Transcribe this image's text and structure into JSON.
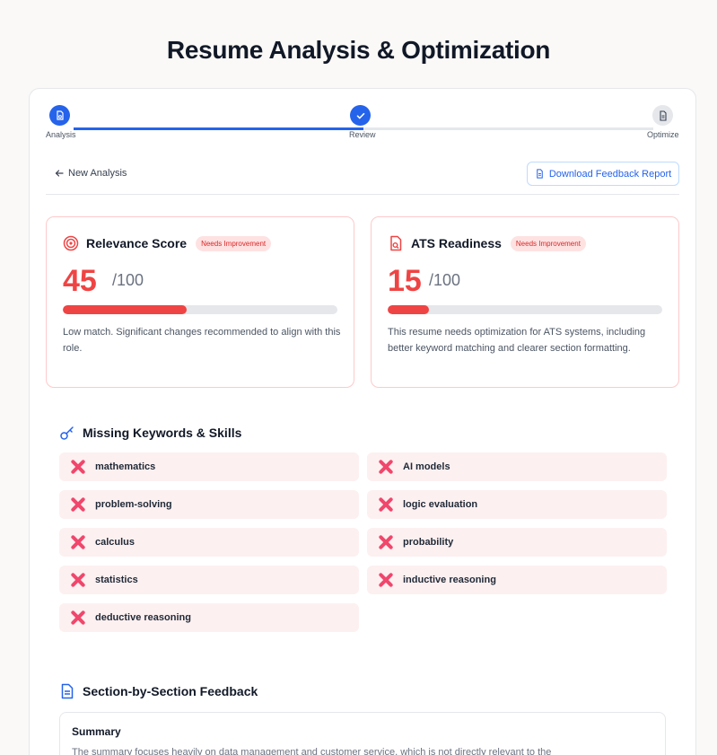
{
  "page_title": "Resume Analysis & Optimization",
  "stepper": {
    "steps": [
      {
        "label": "Analysis",
        "icon": "file-search-icon",
        "state": "complete"
      },
      {
        "label": "Review",
        "icon": "check-icon",
        "state": "current"
      },
      {
        "label": "Optimize",
        "icon": "document-icon",
        "state": "upcoming"
      }
    ],
    "progress": 0.5
  },
  "toolbar": {
    "back_label": "New Analysis",
    "download_label": "Download Feedback Report"
  },
  "scores": [
    {
      "title": "Relevance Score",
      "icon": "target-icon",
      "badge": "Needs Improvement",
      "value": "45",
      "max": "/100",
      "fraction": 0.45,
      "description": "Low match. Significant changes recommended to align with this role."
    },
    {
      "title": "ATS Readiness",
      "icon": "file-search-icon",
      "badge": "Needs Improvement",
      "value": "15",
      "max": "/100",
      "fraction": 0.15,
      "description": "This resume needs optimization for ATS systems, including better keyword matching and clearer section formatting."
    }
  ],
  "missing_keywords": {
    "title": "Missing Keywords & Skills",
    "icon": "key-icon",
    "items": [
      "mathematics",
      "AI models",
      "problem-solving",
      "logic evaluation",
      "calculus",
      "probability",
      "statistics",
      "inductive reasoning",
      "deductive reasoning"
    ]
  },
  "section_feedback": {
    "title": "Section-by-Section Feedback",
    "icon": "document-icon",
    "sections": [
      {
        "title": "Summary",
        "text": "The summary focuses heavily on data management and customer service, which is not directly relevant to the"
      }
    ]
  },
  "colors": {
    "accent": "#2563eb",
    "danger": "#ef4444",
    "badge_bg": "#fee2e2",
    "keyword_bg": "#fdf0f0"
  }
}
